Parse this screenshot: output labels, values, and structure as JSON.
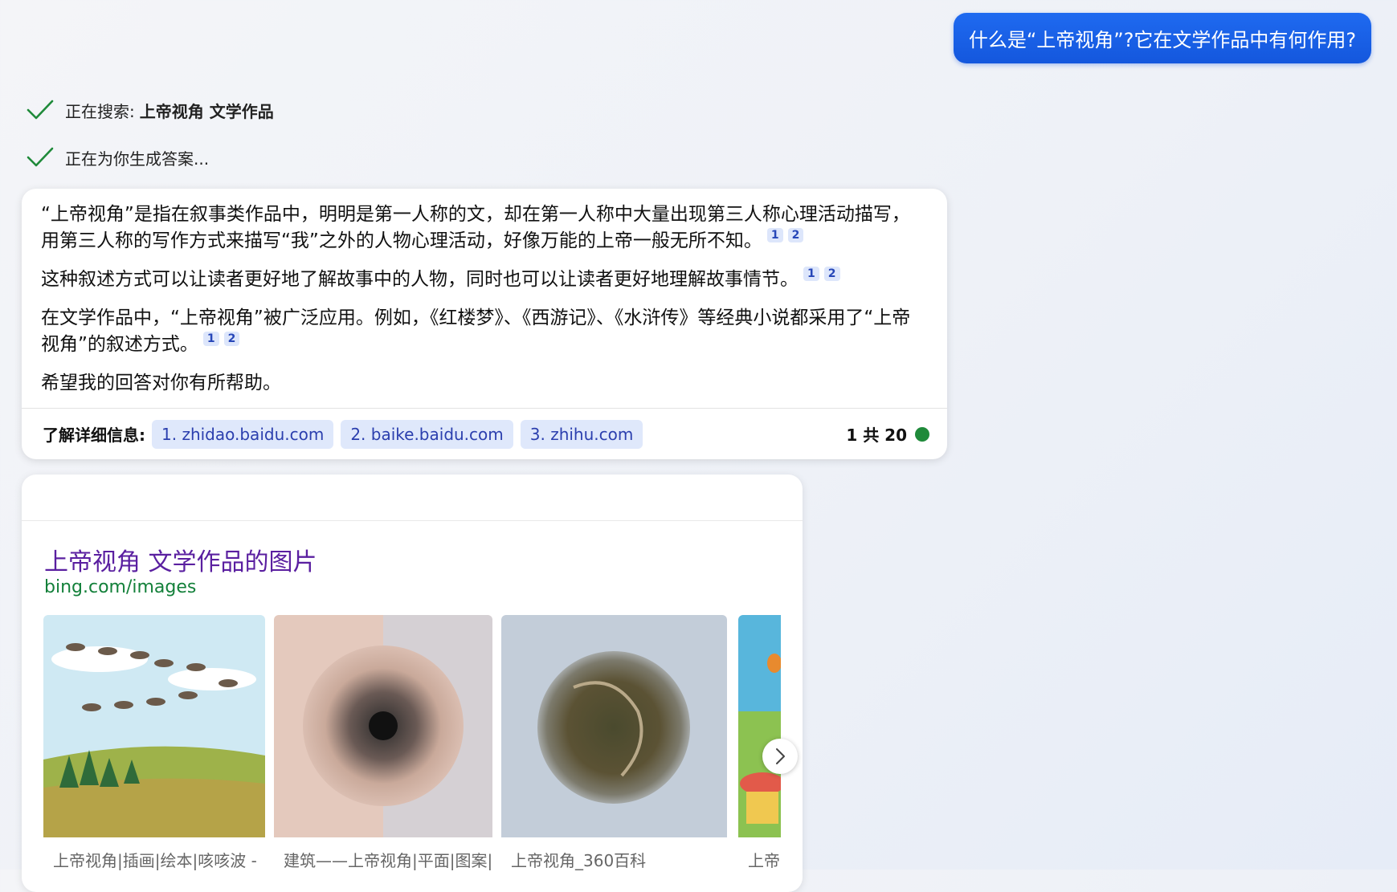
{
  "user_message": "什么是“上帝视角”?它在文学作品中有何作用?",
  "status": {
    "searching_prefix": "正在搜索:",
    "searching_query": "上帝视角 文学作品",
    "generating": "正在为你生成答案..."
  },
  "answer": {
    "paragraphs": [
      {
        "text": "“上帝视角”是指在叙事类作品中，明明是第一人称的文，却在第一人称中大量出现第三人称心理活动描写，用第三人称的写作方式来描写“我”之外的人物心理活动，好像万能的上帝一般无所不知。",
        "cites": [
          "1",
          "2"
        ]
      },
      {
        "text": "这种叙述方式可以让读者更好地了解故事中的人物，同时也可以让读者更好地理解故事情节。",
        "cites": [
          "1",
          "2"
        ]
      },
      {
        "text": "在文学作品中，“上帝视角”被广泛应用。例如，《红楼梦》、《西游记》、《水浒传》等经典小说都采用了“上帝视角”的叙述方式。",
        "cites": [
          "1",
          "2"
        ]
      },
      {
        "text": "希望我的回答对你有所帮助。",
        "cites": []
      }
    ],
    "learn_more_label": "了解详细信息:",
    "sources": [
      "1. zhidao.baidu.com",
      "2. baike.baidu.com",
      "3. zhihu.com"
    ],
    "page_count": "1 共 20"
  },
  "images": {
    "title": "上帝视角 文学作品的图片",
    "source": "bing.com/images",
    "captions": [
      "上帝视角|插画|绘本|咳咳波 -",
      "建筑——上帝视角|平面|图案|",
      "上帝视角_360百科",
      "上帝"
    ]
  },
  "colors": {
    "accent_blue": "#1f6af0",
    "check_green": "#1f8a3a",
    "link_purple": "#5a1fa0",
    "source_green": "#13803a"
  },
  "icons": {
    "check": "check-icon",
    "status_dot": "status-dot-icon",
    "next": "chevron-right-icon"
  }
}
